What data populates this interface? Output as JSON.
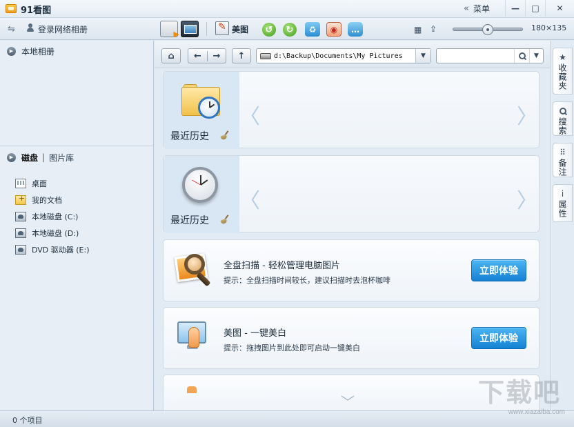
{
  "app": {
    "title": "91看图",
    "menu_label": "菜单",
    "menu_chevron": "«",
    "minimize": "—",
    "maximize": "□",
    "close": "✕"
  },
  "toolbar": {
    "usb_glyph": "⇋",
    "login_label": "登录网络相册",
    "meitu_label": "美图",
    "rotate_left_glyph": "↺",
    "rotate_right_glyph": "↻",
    "delete_glyph": "♻",
    "wallpaper_glyph": "◉",
    "chat_glyph": "…",
    "grid_glyph": "▦",
    "export_glyph": "⇪",
    "zoom_level": 0.5,
    "thumb_size_label": "180×135"
  },
  "sidebar": {
    "local_album_label": "本地相册",
    "tab_disk": "磁盘",
    "tab_separator": "|",
    "tab_library": "图片库",
    "tree": [
      {
        "label": "桌面",
        "icon": "desktop-icon"
      },
      {
        "label": "我的文档",
        "icon": "documents-icon"
      },
      {
        "label": "本地磁盘 (C:)",
        "icon": "drive-icon"
      },
      {
        "label": "本地磁盘 (D:)",
        "icon": "drive-icon"
      },
      {
        "label": "DVD 驱动器 (E:)",
        "icon": "drive-icon"
      }
    ]
  },
  "nav": {
    "home_glyph": "⌂",
    "back_glyph": "←",
    "forward_glyph": "→",
    "up_glyph": "↑",
    "path": "d:\\Backup\\Documents\\My Pictures",
    "dropdown_glyph": "▼",
    "search_placeholder": ""
  },
  "history": [
    {
      "label": "最近历史",
      "icon": "folder-clock-icon"
    },
    {
      "label": "最近历史",
      "icon": "clock-icon"
    }
  ],
  "arrows": {
    "left": "〈",
    "right": "〉"
  },
  "features": [
    {
      "title": "全盘扫描 - 轻松管理电脑图片",
      "tip": "提示：全盘扫描时间较长，建议扫描时去泡杯咖啡",
      "button": "立即体验"
    },
    {
      "title": "美图 - 一键美白",
      "tip": "提示：拖拽图片到此处即可启动一键美白",
      "button": "立即体验"
    }
  ],
  "scroll_more_glyph": "﹀",
  "right_tabs": [
    {
      "label": "收藏夹",
      "glyph": "★"
    },
    {
      "label": "搜索",
      "glyph": ""
    },
    {
      "label": "备注",
      "glyph": "⠿"
    },
    {
      "label": "属性",
      "glyph": "i"
    }
  ],
  "status": {
    "text": "0 个项目"
  },
  "watermark": {
    "main": "下载吧",
    "sub": "www.xiazaiba.com"
  }
}
